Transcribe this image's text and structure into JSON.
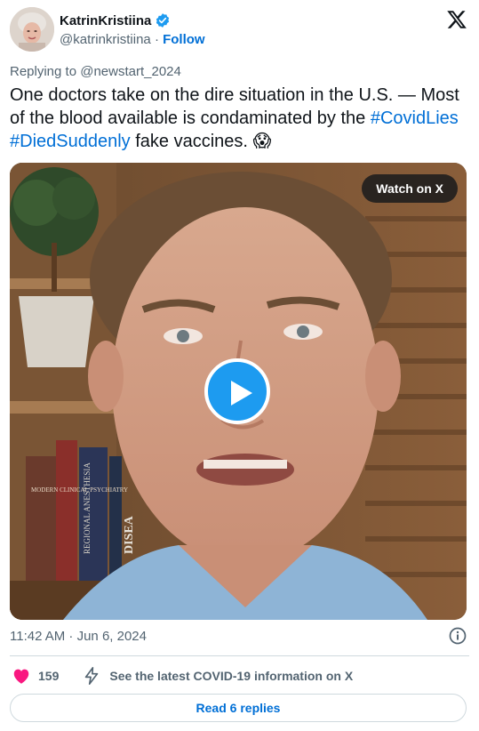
{
  "author": {
    "display_name": "KatrinKristiina",
    "handle": "@katrinkristiina",
    "separator": "·",
    "follow_label": "Follow"
  },
  "icons": {
    "verified": "verified-badge-icon",
    "platform": "x-logo-icon",
    "info": "info-icon",
    "like": "heart-icon",
    "covid": "lightning-bolt-icon",
    "play": "play-icon"
  },
  "replying_to": "Replying to @newstart_2024",
  "tweet": {
    "text_before": "One doctors take on the dire situation in the U.S. — Most of the blood available is condaminated by the ",
    "hashtag_1": "#CovidLies",
    "space": " ",
    "hashtag_2": "#DiedSuddenly",
    "text_after": " fake vaccines. ",
    "emoji": "😱"
  },
  "video": {
    "watch_label": "Watch on X",
    "spine_1": "MODERN CLINICAL PSYCHIATRY",
    "spine_2": "REGIONAL ANESTHESIA",
    "spine_3": "DISEA"
  },
  "timestamp": "11:42 AM · Jun 6, 2024",
  "actions": {
    "like_count": "159",
    "covid_info": "See the latest COVID-19 information on X"
  },
  "replies_label": "Read 6 replies",
  "colors": {
    "link": "#006fd6",
    "verified": "#1d9bf0",
    "heart": "#f91880",
    "play": "#1d9bf0",
    "muted": "#536471"
  }
}
